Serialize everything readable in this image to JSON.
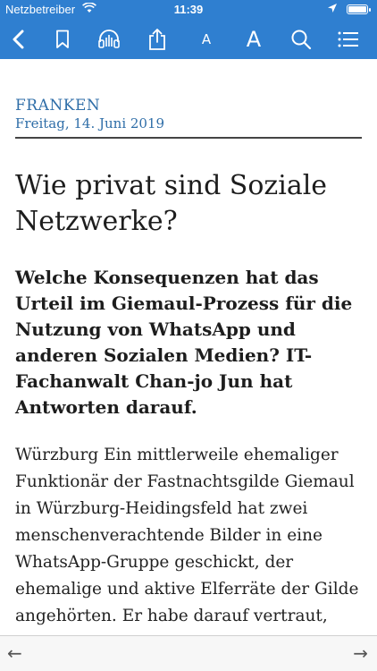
{
  "status_bar": {
    "carrier": "Netzbetreiber",
    "time": "11:39"
  },
  "toolbar": {
    "font_small_label": "A",
    "font_large_label": "A",
    "accent_color": "#2f7fd0",
    "icons": [
      "back-icon",
      "bookmark-icon",
      "headphones-icon",
      "share-icon",
      "font-decrease-icon",
      "font-increase-icon",
      "search-icon",
      "menu-icon"
    ]
  },
  "article": {
    "section": "FRANKEN",
    "date": "Freitag, 14. Juni 2019",
    "headline": "Wie privat sind Soziale Netzwerke?",
    "lead": "Welche Konsequenzen hat das Urteil im Giemaul-Prozess für die Nutzung von WhatsApp und anderen Sozialen Medien? IT-Fachanwalt Chan-jo Jun hat Antworten darauf.",
    "body": "Würzburg Ein mittlerweile ehemaliger Funktionär der Fastnachtsgilde Giemaul in Würzburg-Heidingsfeld hat zwei menschenverachtende Bilder in eine WhatsApp-Gruppe geschickt, der ehemalige und aktive Elferräte der Gilde angehörten. Er habe darauf vertraut, dass aus der „verschworenen"
  },
  "bottom_bar": {
    "prev_arrow": "←",
    "next_arrow": "→"
  }
}
